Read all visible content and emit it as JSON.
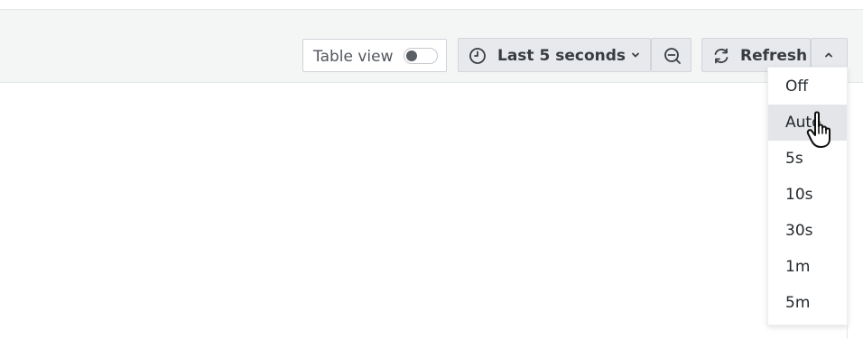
{
  "toolbar": {
    "table_view_label": "Table view",
    "table_view_on": false,
    "time_range_label": "Last 5 seconds",
    "refresh_label": "Refresh",
    "icons": {
      "clock": "clock-icon",
      "chevron_down": "chevron-down-icon",
      "zoom_out": "zoom-out-icon",
      "sync": "sync-icon",
      "chevron_up": "chevron-up-icon"
    }
  },
  "refresh_menu": {
    "items": [
      "Off",
      "Auto",
      "5s",
      "10s",
      "30s",
      "1m",
      "5m"
    ],
    "highlighted": "Auto"
  },
  "colors": {
    "toolbar_bg": "#f4f5f5",
    "button_bg": "#e7e9ec",
    "highlight": "#e3e5e8"
  }
}
